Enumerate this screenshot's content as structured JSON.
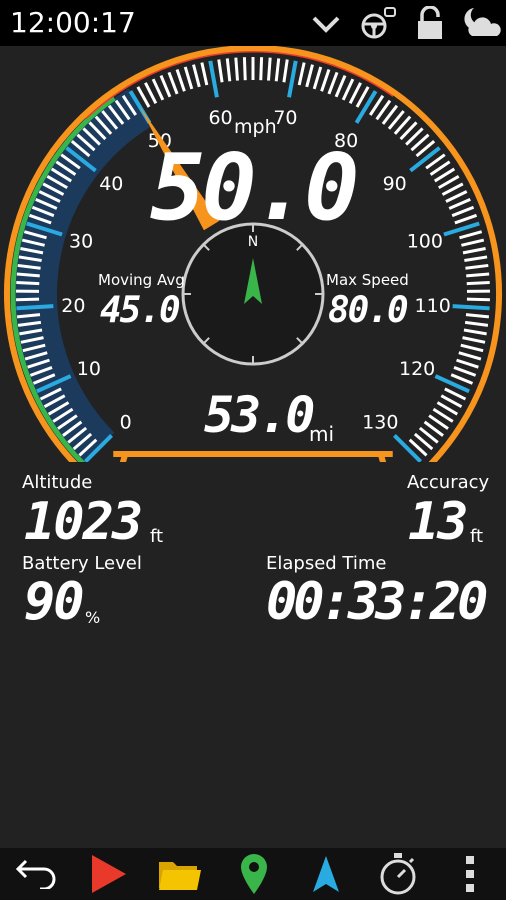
{
  "status_bar": {
    "time": "12:00:17",
    "icons": [
      "chevron-down-icon",
      "steering-wheel-icon",
      "lock-icon",
      "weather-cloud-moon-icon"
    ]
  },
  "speedometer": {
    "speed_value": "50.0",
    "speed_unit": "mph",
    "needle_speed_mph": 50,
    "dial_labels": [
      "0",
      "10",
      "20",
      "30",
      "40",
      "50",
      "60",
      "70",
      "80",
      "90",
      "100",
      "110",
      "120",
      "130"
    ],
    "moving_avg_label": "Moving Avg",
    "moving_avg_value": "45.0",
    "max_speed_label": "Max Speed",
    "max_speed_value": "80.0",
    "odometer_value": "53.0",
    "odometer_unit": "mi",
    "compass_label": "N"
  },
  "stats": {
    "altitude_label": "Altitude",
    "altitude_value": "1023",
    "altitude_unit": "ft",
    "accuracy_label": "Accuracy",
    "accuracy_value": "13",
    "accuracy_unit": "ft",
    "battery_label": "Battery Level",
    "battery_value": "90",
    "battery_unit": "%",
    "elapsed_label": "Elapsed Time",
    "elapsed_value": "00:33:20"
  },
  "bottom_bar": {
    "buttons": [
      "back-icon",
      "play-icon",
      "folder-icon",
      "map-pin-icon",
      "navigation-arrow-icon",
      "stopwatch-icon",
      "more-icon"
    ]
  },
  "colors": {
    "orange": "#F7941D",
    "blue_tick": "#29ABE2",
    "green": "#39B54A",
    "red": "#E8392A",
    "background": "#222222"
  }
}
